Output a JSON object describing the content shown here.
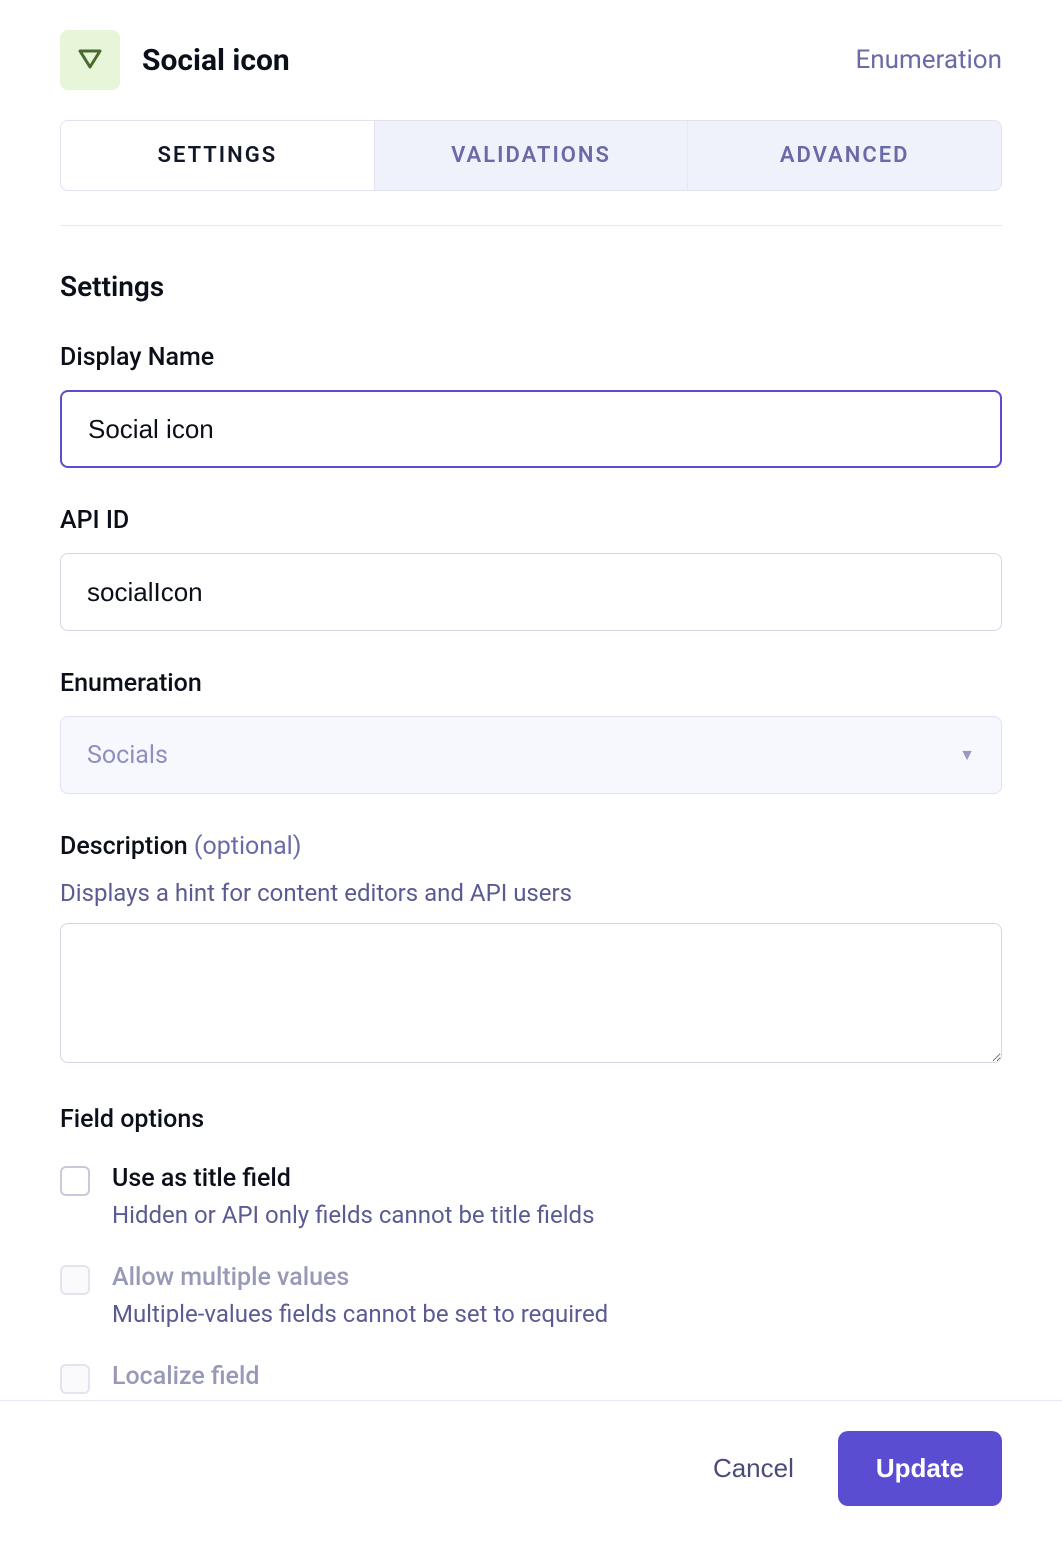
{
  "header": {
    "title": "Social icon",
    "type_label": "Enumeration"
  },
  "tabs": {
    "settings": "SETTINGS",
    "validations": "VALIDATIONS",
    "advanced": "ADVANCED"
  },
  "section_title": "Settings",
  "form": {
    "display_name": {
      "label": "Display Name",
      "value": "Social icon"
    },
    "api_id": {
      "label": "API ID",
      "value": "socialIcon"
    },
    "enumeration": {
      "label": "Enumeration",
      "selected": "Socials"
    },
    "description": {
      "label": "Description",
      "optional_tag": "(optional)",
      "hint": "Displays a hint for content editors and API users",
      "value": ""
    }
  },
  "field_options": {
    "title": "Field options",
    "options": [
      {
        "label": "Use as title field",
        "hint": "Hidden or API only fields cannot be title fields",
        "disabled": false
      },
      {
        "label": "Allow multiple values",
        "hint": "Multiple-values fields cannot be set to required",
        "disabled": true
      },
      {
        "label": "Localize field",
        "hint": "",
        "disabled": true
      }
    ]
  },
  "footer": {
    "cancel": "Cancel",
    "update": "Update"
  }
}
